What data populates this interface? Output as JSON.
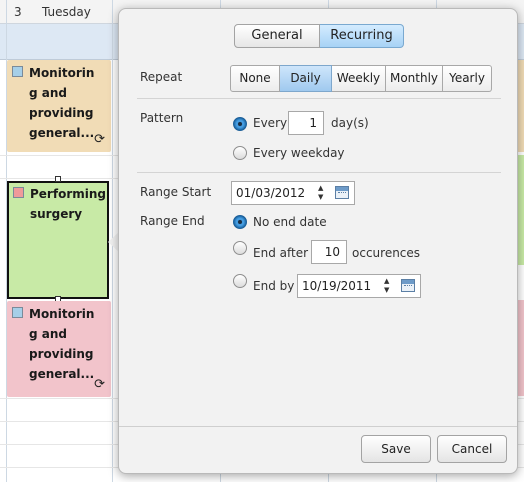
{
  "calendar": {
    "day_number": "3",
    "day_name": "Tuesday",
    "events": [
      {
        "title": "Monitoring and providing general...",
        "lines": [
          "Monitorin",
          "g and",
          "providing",
          "general..."
        ],
        "color": "#f1dcb6",
        "marker_color": "#a6cfe8",
        "recurring": true
      },
      {
        "title": "Performing surgery",
        "lines": [
          "Performing",
          "surgery"
        ],
        "color": "#c8eaa6",
        "marker_color": "#f09a9a",
        "recurring": false
      },
      {
        "title": "Monitoring and providing general...",
        "lines": [
          "Monitorin",
          "g and",
          "providing",
          "general..."
        ],
        "color": "#f2c4cb",
        "marker_color": "#a6cfe8",
        "recurring": true
      }
    ]
  },
  "dialog": {
    "tabs": [
      {
        "label": "General",
        "active": false
      },
      {
        "label": "Recurring",
        "active": true
      }
    ],
    "repeat": {
      "label": "Repeat",
      "options": [
        "None",
        "Daily",
        "Weekly",
        "Monthly",
        "Yearly"
      ],
      "selected": "Daily"
    },
    "pattern": {
      "label": "Pattern",
      "every_label": "Every",
      "every_value": "1",
      "unit_label": "day(s)",
      "weekday_label": "Every weekday",
      "selected": "every"
    },
    "range_start": {
      "label": "Range Start",
      "value": "01/03/2012"
    },
    "range_end": {
      "label": "Range End",
      "no_end_label": "No end date",
      "end_after_label": "End after",
      "end_after_value": "10",
      "occurrences_label": "occurences",
      "end_by_label": "End by",
      "end_by_value": "10/19/2011",
      "selected": "no_end"
    },
    "buttons": {
      "save": "Save",
      "cancel": "Cancel"
    }
  },
  "colors": {
    "accent_blue": "#4aa2e6",
    "selected_segment": "#a7d2f5"
  },
  "icons": [
    "recurrence-icon",
    "calendar-icon",
    "spinner-icon"
  ]
}
